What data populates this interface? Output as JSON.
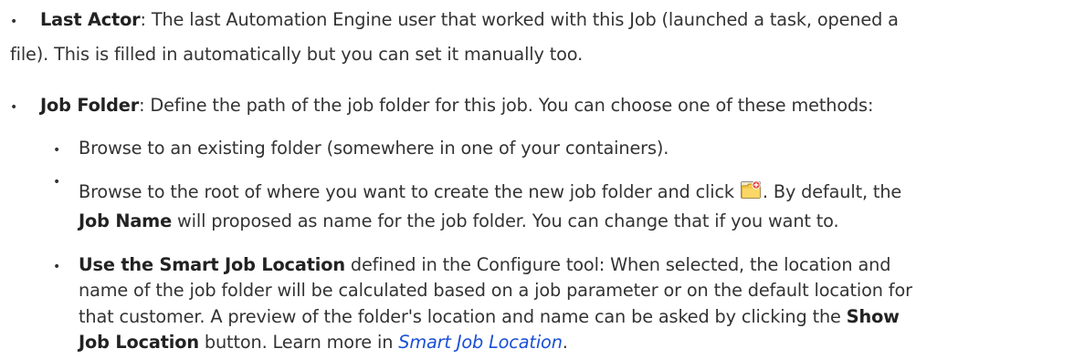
{
  "items": [
    {
      "title": "Last Actor",
      "line1": ": The last Automation Engine user that worked with this Job (launched a task, opened a",
      "line2": "file). This is filled in automatically but you can set it manually too."
    },
    {
      "title": "Job Folder",
      "line1": ": Define the path of the job folder for this job. You can choose one of these methods:",
      "sub": [
        {
          "text": "Browse to an existing folder (somewhere in one of your containers)."
        },
        {
          "line1_before_icon": "Browse to the root of where you want to create the new job folder and click ",
          "line1_after_icon": ". By default, the",
          "line2_bold": "Job Name",
          "line2_rest": " will proposed as name for the job folder. You can change that if you want to."
        },
        {
          "line1_bold": "Use the Smart Job Location",
          "line1_rest": " defined in the Configure tool: When selected, the location and",
          "line2": "name of the job folder will be calculated based on a job parameter or on the default location for",
          "line3_before": "that customer. A preview of the folder's location and name can be asked by clicking the ",
          "line3_bold": "Show",
          "line4_bold": "Job Location",
          "line4_before_link": " button. Learn more in ",
          "line4_link": "Smart Job Location",
          "line4_after_link": "."
        }
      ]
    }
  ],
  "icons": {
    "new_folder": "new-folder-icon"
  }
}
